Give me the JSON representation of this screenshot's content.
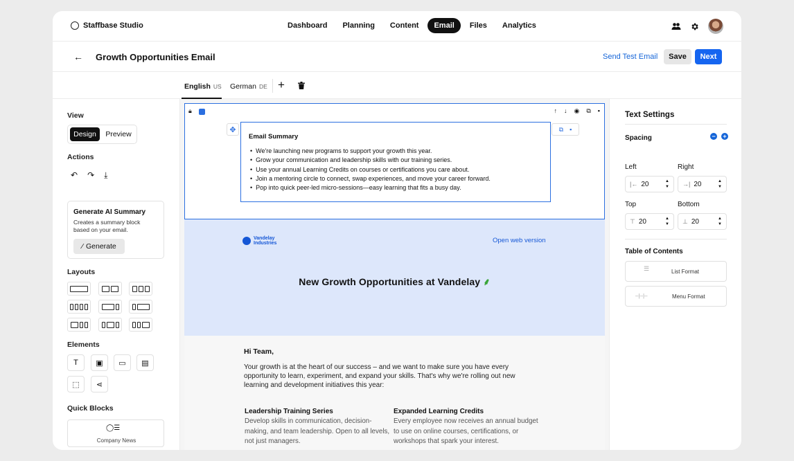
{
  "app": {
    "name": "Staffbase Studio"
  },
  "nav": {
    "items": [
      "Dashboard",
      "Planning",
      "Content",
      "Email",
      "Files",
      "Analytics"
    ],
    "active": "Email"
  },
  "header": {
    "title": "Growth Opportunities Email",
    "send_test": "Send Test Email",
    "save": "Save",
    "next": "Next"
  },
  "languages": [
    {
      "label": "English",
      "code": "US",
      "active": true
    },
    {
      "label": "German",
      "code": "DE",
      "active": false
    }
  ],
  "left": {
    "view_heading": "View",
    "view_design": "Design",
    "view_preview": "Preview",
    "actions_heading": "Actions",
    "ai": {
      "title": "Generate AI Summary",
      "desc": "Creates a summary block based on your email.",
      "button": "Generate"
    },
    "layouts_heading": "Layouts",
    "elements_heading": "Elements",
    "quick_heading": "Quick Blocks",
    "quick_items": [
      "Company News"
    ]
  },
  "summary": {
    "title": "Email Summary",
    "bullets": [
      "We're launching new programs to support your growth this year.",
      "Grow your communication and leadership skills with our training series.",
      "Use your annual Learning Credits on courses or certifications you care about.",
      "Join a mentoring circle to connect, swap experiences, and move your career forward.",
      "Pop into quick peer-led micro-sessions—easy learning that fits a busy day."
    ]
  },
  "hero": {
    "brand_line1": "Vandelay",
    "brand_line2": "Industries",
    "web_version": "Open web version",
    "title": "New Growth Opportunities at Vandelay"
  },
  "body": {
    "greeting": "Hi Team,",
    "paragraph": "Your growth is at the heart of our success – and we want to make sure you have every opportunity to learn, experiment, and expand your skills. That's why we're rolling out new learning and development initiatives this year:",
    "col1_title": "Leadership Training Series",
    "col1_text": "Develop skills in communication, decision-making, and team leadership. Open to all levels, not just managers.",
    "col2_title": "Expanded Learning Credits",
    "col2_text": "Every employee now receives an annual budget to use on online courses, certifications, or workshops that spark your interest."
  },
  "right": {
    "title": "Text Settings",
    "spacing": "Spacing",
    "left_label": "Left",
    "left_value": "20",
    "right_label": "Right",
    "right_value": "20",
    "top_label": "Top",
    "top_value": "20",
    "bottom_label": "Bottom",
    "bottom_value": "20",
    "toc_heading": "Table of Contents",
    "toc_list": "List Format",
    "toc_menu": "Menu Format"
  },
  "colors": {
    "accent": "#1565f0",
    "hero_bg": "#dde7fb",
    "selection": "#2b6fe0"
  }
}
